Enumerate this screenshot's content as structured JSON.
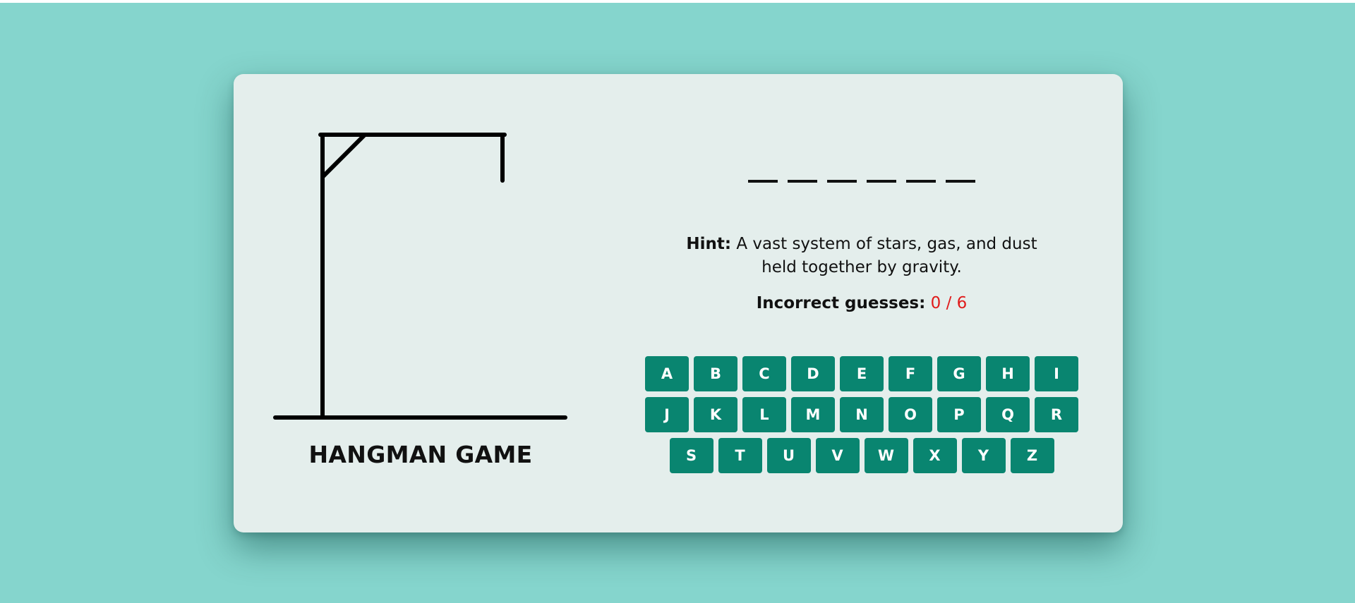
{
  "game": {
    "title": "HANGMAN GAME",
    "word_length": 6,
    "hint_label": "Hint:",
    "hint_text": "A vast system of stars, gas, and dust held together by gravity.",
    "guesses_label": "Incorrect guesses:",
    "guesses_value": "0 / 6",
    "incorrect_guesses": 0,
    "max_guesses": 6
  },
  "keyboard": {
    "rows": [
      [
        "A",
        "B",
        "C",
        "D",
        "E",
        "F",
        "G",
        "H",
        "I"
      ],
      [
        "J",
        "K",
        "L",
        "M",
        "N",
        "O",
        "P",
        "Q",
        "R"
      ],
      [
        "S",
        "T",
        "U",
        "V",
        "W",
        "X",
        "Y",
        "Z"
      ]
    ]
  },
  "colors": {
    "background": "#85d5cd",
    "card": "#e4eeec",
    "key": "#098570",
    "key_text": "#ffffff",
    "incorrect_count": "#e01b1b",
    "drawing": "#000000"
  }
}
